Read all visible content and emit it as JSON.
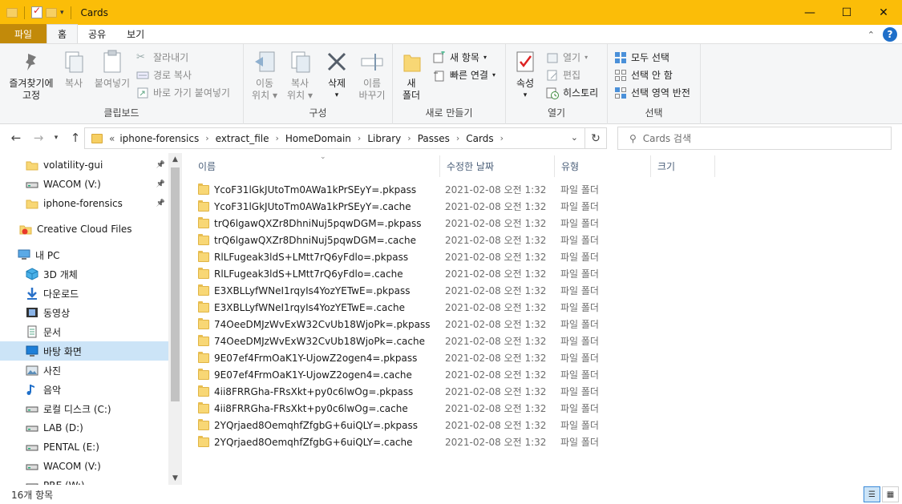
{
  "window": {
    "title": "Cards",
    "controls": [
      "minimize",
      "maximize",
      "close"
    ]
  },
  "ribbon_tabs": [
    "파일",
    "홈",
    "공유",
    "보기"
  ],
  "ribbon": {
    "clipboard": {
      "label": "클립보드",
      "pin_label_1": "즐겨찾기에",
      "pin_label_2": "고정",
      "copy": "복사",
      "paste": "붙여넣기",
      "cut": "잘라내기",
      "copy_path": "경로 복사",
      "paste_shortcut": "바로 가기 붙여넣기"
    },
    "organize": {
      "label": "구성",
      "move_1": "이동",
      "move_2": "위치",
      "copyto_1": "복사",
      "copyto_2": "위치",
      "delete": "삭제",
      "rename_1": "이름",
      "rename_2": "바꾸기"
    },
    "new": {
      "label": "새로 만들기",
      "new_folder_1": "새",
      "new_folder_2": "폴더",
      "new_item": "새 항목",
      "easy_access": "빠른 연결"
    },
    "open": {
      "label": "열기",
      "properties": "속성",
      "open": "열기",
      "edit": "편집",
      "history": "히스토리"
    },
    "select": {
      "label": "선택",
      "select_all": "모두 선택",
      "select_none": "선택 안 함",
      "invert": "선택 영역 반전"
    }
  },
  "address": {
    "overflow": "«",
    "crumbs": [
      "iphone-forensics",
      "extract_file",
      "HomeDomain",
      "Library",
      "Passes",
      "Cards"
    ]
  },
  "search": {
    "placeholder": "Cards 검색"
  },
  "sidebar": {
    "items": [
      {
        "label": "volatility-gui",
        "icon": "folder-icon",
        "pinned": true
      },
      {
        "label": "WACOM (V:)",
        "icon": "drive-icon",
        "pinned": true
      },
      {
        "label": "iphone-forensics",
        "icon": "folder-icon",
        "pinned": true
      },
      {
        "label": "Creative Cloud Files",
        "icon": "creative-cloud-icon",
        "pinned": false
      },
      {
        "label": "내 PC",
        "icon": "pc-icon",
        "pinned": false
      },
      {
        "label": "3D 개체",
        "icon": "3d-objects-icon",
        "pinned": false
      },
      {
        "label": "다운로드",
        "icon": "download-icon",
        "pinned": false
      },
      {
        "label": "동영상",
        "icon": "video-icon",
        "pinned": false
      },
      {
        "label": "문서",
        "icon": "document-icon",
        "pinned": false
      },
      {
        "label": "바탕 화면",
        "icon": "desktop-icon",
        "pinned": false,
        "selected": true
      },
      {
        "label": "사진",
        "icon": "pictures-icon",
        "pinned": false
      },
      {
        "label": "음악",
        "icon": "music-icon",
        "pinned": false
      },
      {
        "label": "로컬 디스크 (C:)",
        "icon": "drive-icon",
        "pinned": false
      },
      {
        "label": "LAB (D:)",
        "icon": "drive-icon",
        "pinned": false
      },
      {
        "label": "PENTAL (E:)",
        "icon": "drive-icon",
        "pinned": false
      },
      {
        "label": "WACOM (V:)",
        "icon": "drive-icon",
        "pinned": false
      },
      {
        "label": "PRE (W:)",
        "icon": "drive-icon",
        "pinned": false
      }
    ]
  },
  "columns": {
    "name": "이름",
    "modified": "수정한 날짜",
    "type": "유형",
    "size": "크기"
  },
  "files": [
    {
      "name": "YcoF31lGkJUtoTm0AWa1kPrSEyY=.pkpass",
      "modified": "2021-02-08 오전 1:32",
      "type": "파일 폴더"
    },
    {
      "name": "YcoF31lGkJUtoTm0AWa1kPrSEyY=.cache",
      "modified": "2021-02-08 오전 1:32",
      "type": "파일 폴더"
    },
    {
      "name": "trQ6lgawQXZr8DhniNuj5pqwDGM=.pkpass",
      "modified": "2021-02-08 오전 1:32",
      "type": "파일 폴더"
    },
    {
      "name": "trQ6lgawQXZr8DhniNuj5pqwDGM=.cache",
      "modified": "2021-02-08 오전 1:32",
      "type": "파일 폴더"
    },
    {
      "name": "RlLFugeak3ldS+LMtt7rQ6yFdlo=.pkpass",
      "modified": "2021-02-08 오전 1:32",
      "type": "파일 폴더"
    },
    {
      "name": "RlLFugeak3ldS+LMtt7rQ6yFdlo=.cache",
      "modified": "2021-02-08 오전 1:32",
      "type": "파일 폴더"
    },
    {
      "name": "E3XBLLyfWNeI1rqyIs4YozYETwE=.pkpass",
      "modified": "2021-02-08 오전 1:32",
      "type": "파일 폴더"
    },
    {
      "name": "E3XBLLyfWNeI1rqyIs4YozYETwE=.cache",
      "modified": "2021-02-08 오전 1:32",
      "type": "파일 폴더"
    },
    {
      "name": "74OeeDMJzWvExW32CvUb18WjoPk=.pkpass",
      "modified": "2021-02-08 오전 1:32",
      "type": "파일 폴더"
    },
    {
      "name": "74OeeDMJzWvExW32CvUb18WjoPk=.cache",
      "modified": "2021-02-08 오전 1:32",
      "type": "파일 폴더"
    },
    {
      "name": "9E07ef4FrmOaK1Y-UjowZ2ogen4=.pkpass",
      "modified": "2021-02-08 오전 1:32",
      "type": "파일 폴더"
    },
    {
      "name": "9E07ef4FrmOaK1Y-UjowZ2ogen4=.cache",
      "modified": "2021-02-08 오전 1:32",
      "type": "파일 폴더"
    },
    {
      "name": "4ii8FRRGha-FRsXkt+py0c6lwOg=.pkpass",
      "modified": "2021-02-08 오전 1:32",
      "type": "파일 폴더"
    },
    {
      "name": "4ii8FRRGha-FRsXkt+py0c6lwOg=.cache",
      "modified": "2021-02-08 오전 1:32",
      "type": "파일 폴더"
    },
    {
      "name": "2YQrjaed8OemqhfZfgbG+6uiQLY=.pkpass",
      "modified": "2021-02-08 오전 1:32",
      "type": "파일 폴더"
    },
    {
      "name": "2YQrjaed8OemqhfZfgbG+6uiQLY=.cache",
      "modified": "2021-02-08 오전 1:32",
      "type": "파일 폴더"
    }
  ],
  "status": {
    "item_count": "16개 항목"
  },
  "colors": {
    "titlebar": "#fbbd08",
    "file_tab": "#c28a0a",
    "selection": "#cce4f7"
  }
}
